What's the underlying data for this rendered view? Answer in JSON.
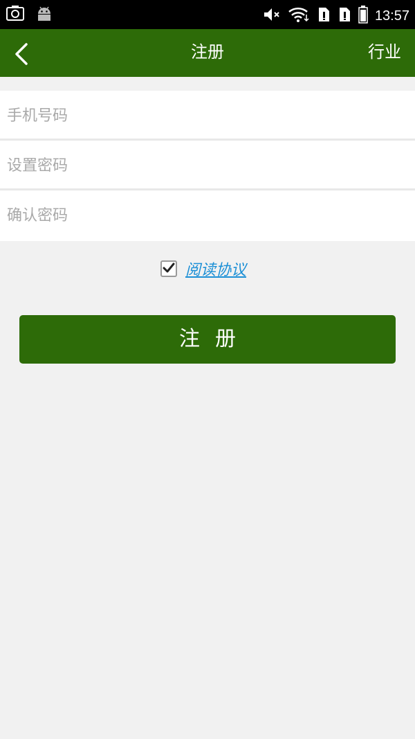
{
  "status_bar": {
    "time": "13:57",
    "icons": [
      "screenshot-icon",
      "android-icon",
      "mute-icon",
      "wifi-icon",
      "sim1-icon",
      "sim2-icon",
      "battery-icon"
    ]
  },
  "header": {
    "back_icon": "chevron-left-icon",
    "title": "注册",
    "right_label": "行业",
    "background": "#2d6b08"
  },
  "form": {
    "phone_placeholder": "手机号码",
    "password_placeholder": "设置密码",
    "confirm_placeholder": "确认密码"
  },
  "agreement": {
    "checked": true,
    "link_label": "阅读协议",
    "link_color": "#1b8fd6"
  },
  "submit": {
    "label": "注册"
  }
}
